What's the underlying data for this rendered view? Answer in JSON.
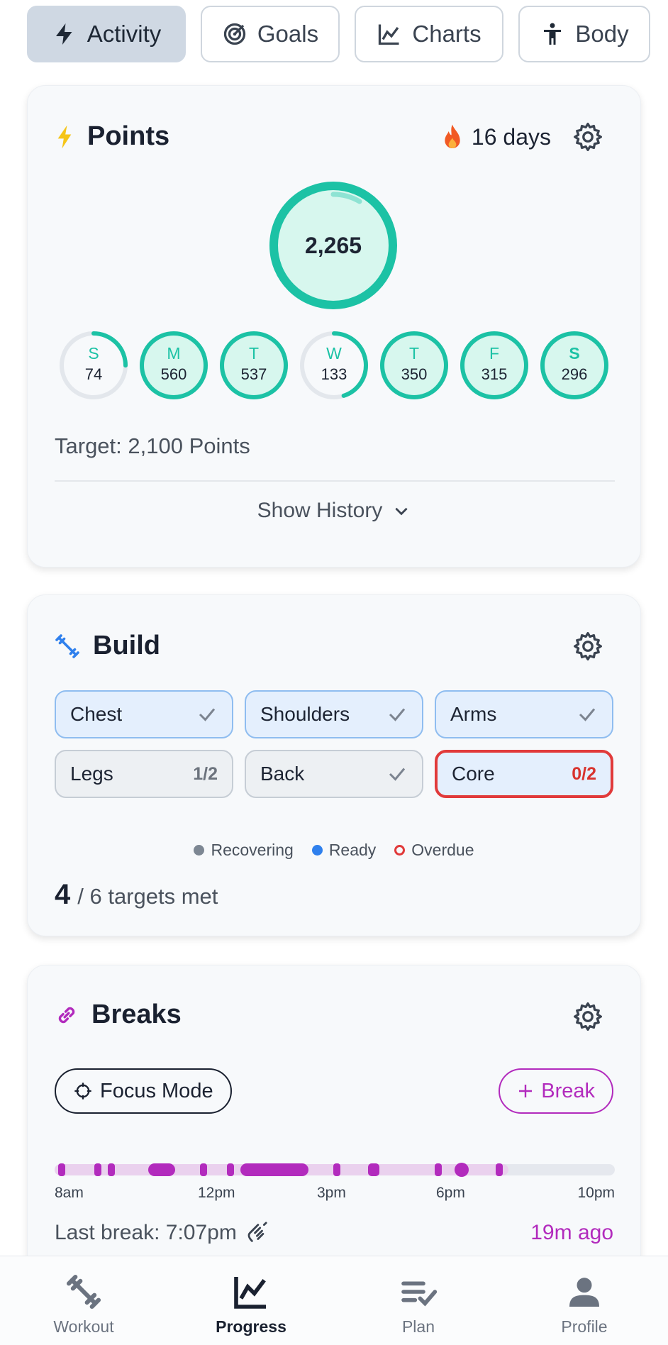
{
  "top_tabs": [
    {
      "label": "Activity",
      "icon": "bolt-icon",
      "active": true
    },
    {
      "label": "Goals",
      "icon": "target-icon",
      "active": false
    },
    {
      "label": "Charts",
      "icon": "chart-line-icon",
      "active": false
    },
    {
      "label": "Body",
      "icon": "person-icon",
      "active": false
    }
  ],
  "points": {
    "title": "Points",
    "streak": "16 days",
    "total": "2,265",
    "days": [
      {
        "letter": "S",
        "value": "74",
        "progress": 0.25,
        "complete": false
      },
      {
        "letter": "M",
        "value": "560",
        "progress": 1.0,
        "complete": true
      },
      {
        "letter": "T",
        "value": "537",
        "progress": 1.0,
        "complete": true
      },
      {
        "letter": "W",
        "value": "133",
        "progress": 0.45,
        "complete": false
      },
      {
        "letter": "T",
        "value": "350",
        "progress": 1.0,
        "complete": true
      },
      {
        "letter": "F",
        "value": "315",
        "progress": 1.0,
        "complete": true
      },
      {
        "letter": "S",
        "value": "296",
        "progress": 1.0,
        "complete": false,
        "today": true
      }
    ],
    "target": "Target: 2,100 Points",
    "show_history": "Show History"
  },
  "build": {
    "title": "Build",
    "chips": [
      {
        "label": "Chest",
        "status": "check",
        "style": "blue"
      },
      {
        "label": "Shoulders",
        "status": "check",
        "style": "blue"
      },
      {
        "label": "Arms",
        "status": "check",
        "style": "blue"
      },
      {
        "label": "Legs",
        "status": "1/2",
        "style": "grey"
      },
      {
        "label": "Back",
        "status": "check",
        "style": "grey"
      },
      {
        "label": "Core",
        "status": "0/2",
        "style": "red"
      }
    ],
    "legend": {
      "recovering": "Recovering",
      "ready": "Ready",
      "overdue": "Overdue"
    },
    "met_count": "4",
    "met_text": "/ 6 targets met"
  },
  "breaks": {
    "title": "Breaks",
    "focus_mode": "Focus Mode",
    "add_break": "Break",
    "timeline_labels": [
      "8am",
      "12pm",
      "3pm",
      "6pm",
      "10pm"
    ],
    "last_break": "Last break: 7:07pm",
    "ago": "19m ago"
  },
  "nav": [
    {
      "label": "Workout",
      "icon": "dumbbell-icon",
      "active": false
    },
    {
      "label": "Progress",
      "icon": "progress-chart-icon",
      "active": true
    },
    {
      "label": "Plan",
      "icon": "checklist-icon",
      "active": false
    },
    {
      "label": "Profile",
      "icon": "profile-icon",
      "active": false
    }
  ],
  "colors": {
    "accent_teal": "#1cc2a5",
    "accent_purple": "#b22bbd",
    "overdue_red": "#e13a3a",
    "ready_blue": "#2f80ed"
  }
}
